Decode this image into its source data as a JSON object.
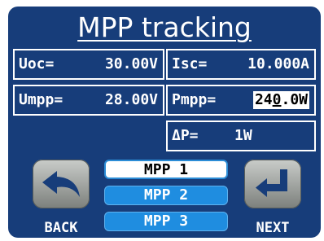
{
  "title": "MPP tracking",
  "fields": {
    "uoc": {
      "label": "Uoc=",
      "value": "30.00V"
    },
    "isc": {
      "label": "Isc=",
      "value": "10.000A"
    },
    "umpp": {
      "label": "Umpp=",
      "value": "28.00V"
    },
    "pmpp": {
      "label": "Pmpp=",
      "value_pre": "24",
      "value_cursor": "0",
      "value_post": ".0W"
    },
    "dp": {
      "label": "ΔP=",
      "value": "1W"
    }
  },
  "modes": [
    {
      "label": "MPP 1",
      "selected": true
    },
    {
      "label": "MPP 2",
      "selected": false
    },
    {
      "label": "MPP 3",
      "selected": false
    }
  ],
  "buttons": {
    "back": {
      "label": "BACK",
      "icon": "undo-arrow-icon"
    },
    "next": {
      "label": "NEXT",
      "icon": "enter-return-icon"
    }
  },
  "colors": {
    "background": "#173d7a",
    "selected_mode": "#ffffff",
    "unselected_mode": "#1f8de0",
    "text": "#ffffff"
  }
}
